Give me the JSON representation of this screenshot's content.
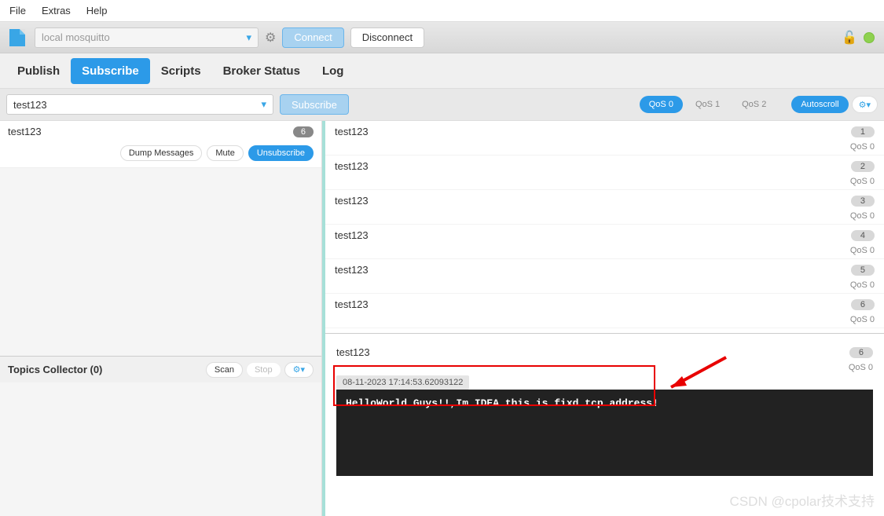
{
  "menu": {
    "file": "File",
    "extras": "Extras",
    "help": "Help"
  },
  "toolbar": {
    "connection_placeholder": "local mosquitto",
    "connect_label": "Connect",
    "disconnect_label": "Disconnect"
  },
  "tabs": {
    "publish": "Publish",
    "subscribe": "Subscribe",
    "scripts": "Scripts",
    "broker_status": "Broker Status",
    "log": "Log"
  },
  "subbar": {
    "topic_value": "test123",
    "subscribe_label": "Subscribe",
    "qos0": "QoS 0",
    "qos1": "QoS 1",
    "qos2": "QoS 2",
    "autoscroll": "Autoscroll"
  },
  "subscriptions": [
    {
      "topic": "test123",
      "count": "6",
      "dump": "Dump Messages",
      "mute": "Mute",
      "unsubscribe": "Unsubscribe"
    }
  ],
  "collector": {
    "title": "Topics Collector (0)",
    "scan": "Scan",
    "stop": "Stop"
  },
  "messages": [
    {
      "topic": "test123",
      "index": "1",
      "qos": "QoS 0"
    },
    {
      "topic": "test123",
      "index": "2",
      "qos": "QoS 0"
    },
    {
      "topic": "test123",
      "index": "3",
      "qos": "QoS 0"
    },
    {
      "topic": "test123",
      "index": "4",
      "qos": "QoS 0"
    },
    {
      "topic": "test123",
      "index": "5",
      "qos": "QoS 0"
    },
    {
      "topic": "test123",
      "index": "6",
      "qos": "QoS 0"
    }
  ],
  "detail": {
    "topic": "test123",
    "index": "6",
    "qos": "QoS 0",
    "timestamp": "08-11-2023 17:14:53.62093122",
    "payload": "HelloWorld Guys!!,Im IDEA this is fixd tcp address!"
  },
  "watermark": "CSDN @cpolar技术支持"
}
